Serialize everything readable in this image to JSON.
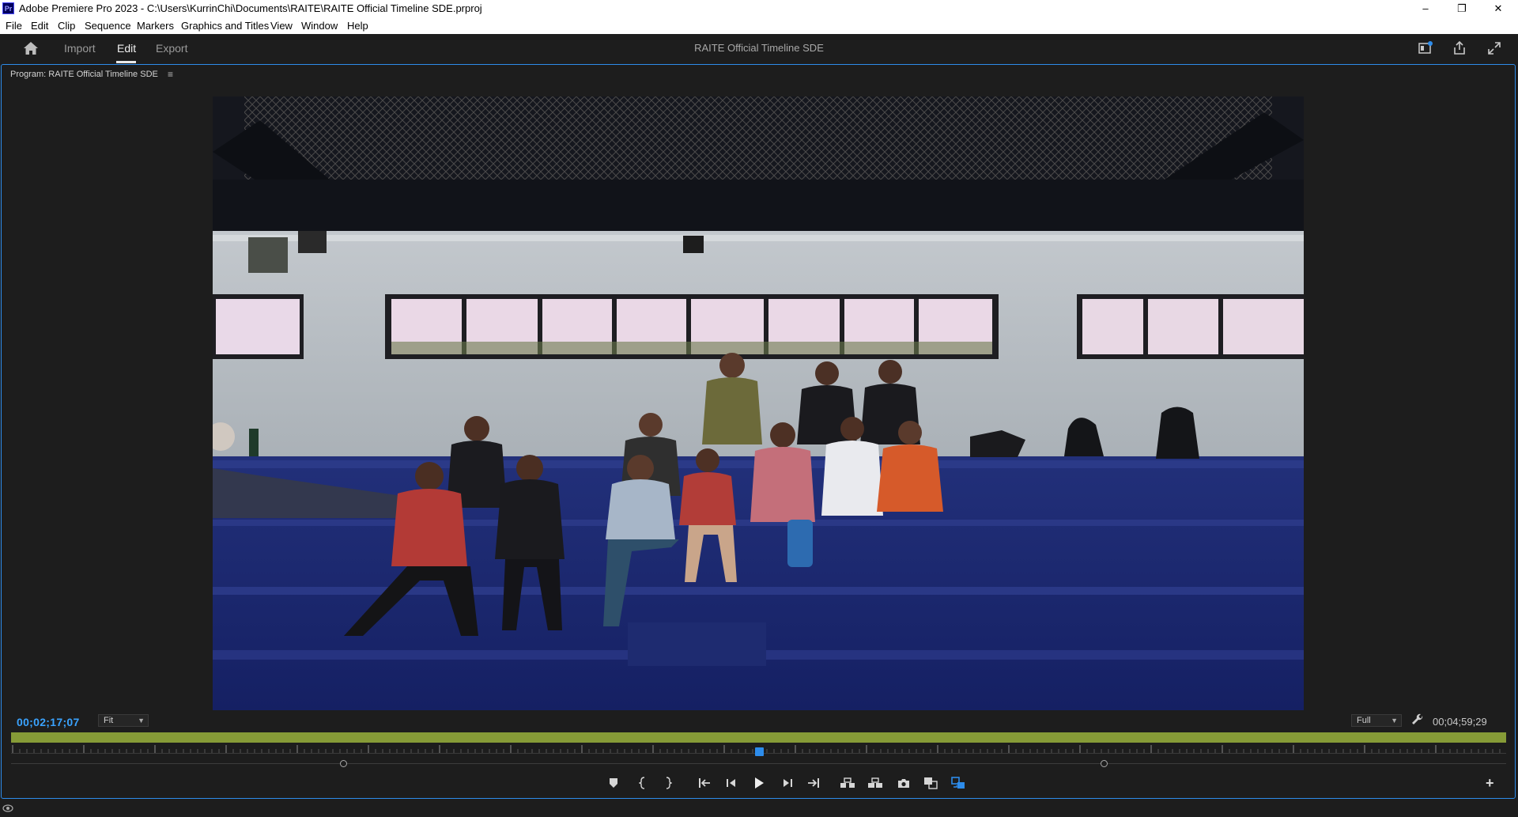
{
  "window": {
    "logo": "Pr",
    "title": "Adobe Premiere Pro 2023 - C:\\Users\\KurrinChi\\Documents\\RAITE\\RAITE Official Timeline SDE.prproj",
    "minimize": "–",
    "maximize": "❐",
    "close": "✕"
  },
  "menu": [
    "File",
    "Edit",
    "Clip",
    "Sequence",
    "Markers",
    "Graphics and Titles",
    "View",
    "Window",
    "Help"
  ],
  "header": {
    "tabs": [
      "Import",
      "Edit",
      "Export"
    ],
    "active_tab": "Edit",
    "sequence_title": "RAITE Official Timeline SDE",
    "icons": [
      "home-icon",
      "quick-export-icon",
      "share-icon",
      "fullscreen-icon"
    ]
  },
  "monitor": {
    "panel_title": "Program: RAITE Official Timeline SDE",
    "panel_menu": "≡",
    "current_timecode": "00;02;17;07",
    "zoom_select": "Fit",
    "resolution_select": "Full",
    "duration_timecode": "00;04;59;29",
    "playhead_position": 0.5,
    "zoom_range": [
      0.222,
      0.731
    ],
    "colors": {
      "accent": "#2d8ceb",
      "work_area": "#869b37",
      "timecode": "#3aa3ff"
    }
  },
  "transport": {
    "buttons": [
      "add-marker",
      "mark-in",
      "mark-out",
      "go-to-in",
      "step-back",
      "play",
      "step-forward",
      "go-to-out",
      "lift",
      "extract",
      "export-frame",
      "comparison-view",
      "proxy-toggle"
    ],
    "add_button": "+"
  }
}
